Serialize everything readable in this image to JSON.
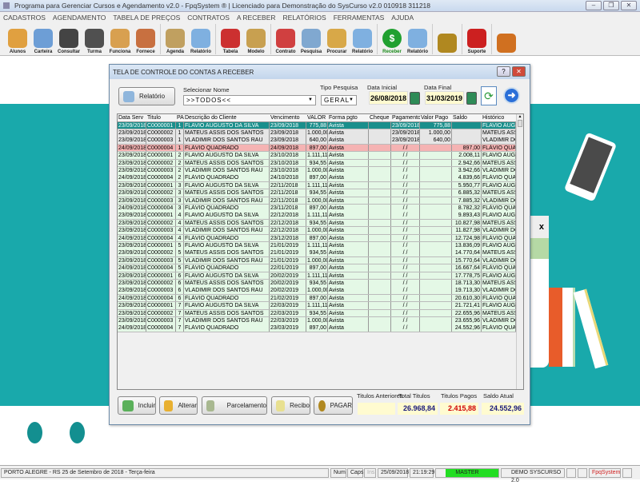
{
  "window": {
    "title": "Programa para Gerenciar Cursos e Agendamento v2.0 - FpqSystem ® | Licenciado para  Demonstração do SysCurso v2.0 010918 311218"
  },
  "menu": [
    "CADASTROS",
    "AGENDAMENTO",
    "TABELA DE PREÇOS",
    "CONTRATOS",
    "A RECEBER",
    "RELATÓRIOS",
    "FERRAMENTAS",
    "AJUDA"
  ],
  "toolbar": [
    {
      "label": "Alunos",
      "icon": "students-icon",
      "color": "#e0a040"
    },
    {
      "label": "Carteira",
      "icon": "id-card-icon",
      "color": "#6d9ed6"
    },
    {
      "label": "Consultar",
      "icon": "consult-icon",
      "color": "#444444"
    },
    {
      "label": "Turma",
      "icon": "classroom-icon",
      "color": "#505050"
    },
    {
      "label": "Funciona",
      "icon": "employee-icon",
      "color": "#d8a050"
    },
    {
      "label": "Fornece",
      "icon": "supplier-icon",
      "color": "#c87040",
      "sep": true
    },
    {
      "label": "Agenda",
      "icon": "calendar-icon",
      "color": "#c0a060"
    },
    {
      "label": "Relatório",
      "icon": "printer-icon",
      "color": "#7fb0e0",
      "sep": true
    },
    {
      "label": "Tabela",
      "icon": "table-doc-icon",
      "color": "#cc3030"
    },
    {
      "label": "Modelo",
      "icon": "scroll-icon",
      "color": "#c8a050",
      "sep": true
    },
    {
      "label": "Contrato",
      "icon": "pen-icon",
      "color": "#d04040"
    },
    {
      "label": "Pesquisa",
      "icon": "search-doc-icon",
      "color": "#80a8d0"
    },
    {
      "label": "Procurar",
      "icon": "archive-icon",
      "color": "#d8a848"
    },
    {
      "label": "Relatório",
      "icon": "printer-icon",
      "color": "#7fb0e0",
      "sep": true
    },
    {
      "label": "Receber",
      "icon": "dollar-icon",
      "color": "#20a030"
    },
    {
      "label": "Relatório",
      "icon": "printer-icon",
      "color": "#7fb0e0",
      "sep": true
    },
    {
      "label": "",
      "icon": "coins-icon",
      "color": "#b08820",
      "sep": true
    },
    {
      "label": "Suporte",
      "icon": "support-icon",
      "color": "#cc2020",
      "sep": true
    },
    {
      "label": "",
      "icon": "exit-icon",
      "color": "#d07020"
    }
  ],
  "dialog": {
    "title": "TELA DE CONTROLE DO CONTAS A RECEBER",
    "report_button": "Relatório",
    "select_name_label": "Selecionar Nome",
    "select_name_value": ">>TODOS<<",
    "search_type_label": "Tipo  Pesquisa",
    "search_type_value": "GERAL",
    "start_date_label": "Data Inicial",
    "start_date": "26/08/2018",
    "end_date_label": "Data Final",
    "end_date": "31/03/2019",
    "columns": [
      "Data Serv",
      "Titulo",
      "PA",
      "Descrição do Cliente",
      "Vencimento",
      "VALOR",
      "Forma pgto",
      "Cheque",
      "Pagamento",
      "Valor Pago",
      "Saldo",
      "Histórico"
    ],
    "row_colors": {
      "selected": "#1a8f8c",
      "paid": "#e6e6e6",
      "overdue": "#f5b3b3",
      "open": "#e4f8e6"
    },
    "rows": [
      [
        "23/09/2018",
        "C0000001",
        "1",
        "FLAVIO AUGUSTO DA SILVA",
        "23/09/2018",
        "775,88",
        "Avista",
        "",
        "23/09/2018",
        "775,88",
        "",
        "FLAVIO AUGU",
        "selected"
      ],
      [
        "23/09/2018",
        "C0000002",
        "1",
        "MATEUS ASSIS DOS SANTOS",
        "23/09/2018",
        "1.000,00",
        "Avista",
        "",
        "23/09/2018",
        "1.000,00",
        "",
        "MATEUS ASSI",
        "paid"
      ],
      [
        "23/09/2018",
        "C0000003",
        "1",
        "VLADIMIR DOS SANTOS RAU",
        "23/09/2018",
        "640,00",
        "Avista",
        "",
        "23/09/2018",
        "640,00",
        "",
        "VLADIMIR DO",
        "paid"
      ],
      [
        "24/09/2018",
        "C0000004",
        "1",
        "FLÁVIO QUADRADO",
        "24/09/2018",
        "897,00",
        "Avista",
        "",
        "/ /",
        "",
        "897,00",
        "FLÁVIO QUAD",
        "overdue"
      ],
      [
        "23/09/2018",
        "C0000001",
        "2",
        "FLAVIO AUGUSTO DA SILVA",
        "23/10/2018",
        "1.111,11",
        "Avista",
        "",
        "/ /",
        "",
        "2.008,11",
        "FLAVIO AUGU",
        "open"
      ],
      [
        "23/09/2018",
        "C0000002",
        "2",
        "MATEUS ASSIS DOS SANTOS",
        "23/10/2018",
        "934,55",
        "Avista",
        "",
        "/ /",
        "",
        "2.942,66",
        "MATEUS ASSI",
        "open"
      ],
      [
        "23/09/2018",
        "C0000003",
        "2",
        "VLADIMIR DOS SANTOS RAU",
        "23/10/2018",
        "1.000,00",
        "Avista",
        "",
        "/ /",
        "",
        "3.942,66",
        "VLADIMIR DO",
        "open"
      ],
      [
        "24/09/2018",
        "C0000004",
        "2",
        "FLÁVIO QUADRADO",
        "24/10/2018",
        "897,00",
        "Avista",
        "",
        "/ /",
        "",
        "4.839,66",
        "FLÁVIO QUAD",
        "open"
      ],
      [
        "23/09/2018",
        "C0000001",
        "3",
        "FLAVIO AUGUSTO DA SILVA",
        "22/11/2018",
        "1.111,11",
        "Avista",
        "",
        "/ /",
        "",
        "5.950,77",
        "FLAVIO AUGU",
        "open"
      ],
      [
        "23/09/2018",
        "C0000002",
        "3",
        "MATEUS ASSIS DOS SANTOS",
        "22/11/2018",
        "934,55",
        "Avista",
        "",
        "/ /",
        "",
        "6.885,32",
        "MATEUS ASSI",
        "open"
      ],
      [
        "23/09/2018",
        "C0000003",
        "3",
        "VLADIMIR DOS SANTOS RAU",
        "22/11/2018",
        "1.000,00",
        "Avista",
        "",
        "/ /",
        "",
        "7.885,32",
        "VLADIMIR DO",
        "open"
      ],
      [
        "24/09/2018",
        "C0000004",
        "3",
        "FLÁVIO QUADRADO",
        "23/11/2018",
        "897,00",
        "Avista",
        "",
        "/ /",
        "",
        "8.782,32",
        "FLÁVIO QUAD",
        "open"
      ],
      [
        "23/09/2018",
        "C0000001",
        "4",
        "FLAVIO AUGUSTO DA SILVA",
        "22/12/2018",
        "1.111,11",
        "Avista",
        "",
        "/ /",
        "",
        "9.893,43",
        "FLAVIO AUGU",
        "open"
      ],
      [
        "23/09/2018",
        "C0000002",
        "4",
        "MATEUS ASSIS DOS SANTOS",
        "22/12/2018",
        "934,55",
        "Avista",
        "",
        "/ /",
        "",
        "10.827,98",
        "MATEUS ASSI",
        "open"
      ],
      [
        "23/09/2018",
        "C0000003",
        "4",
        "VLADIMIR DOS SANTOS RAU",
        "22/12/2018",
        "1.000,00",
        "Avista",
        "",
        "/ /",
        "",
        "11.827,98",
        "VLADIMIR DO",
        "open"
      ],
      [
        "24/09/2018",
        "C0000004",
        "4",
        "FLÁVIO QUADRADO",
        "23/12/2018",
        "897,00",
        "Avista",
        "",
        "/ /",
        "",
        "12.724,98",
        "FLÁVIO QUAD",
        "open"
      ],
      [
        "23/09/2018",
        "C0000001",
        "5",
        "FLAVIO AUGUSTO DA SILVA",
        "21/01/2019",
        "1.111,11",
        "Avista",
        "",
        "/ /",
        "",
        "13.836,09",
        "FLAVIO AUGU",
        "open"
      ],
      [
        "23/09/2018",
        "C0000002",
        "5",
        "MATEUS ASSIS DOS SANTOS",
        "21/01/2019",
        "934,55",
        "Avista",
        "",
        "/ /",
        "",
        "14.770,64",
        "MATEUS ASSI",
        "open"
      ],
      [
        "23/09/2018",
        "C0000003",
        "5",
        "VLADIMIR DOS SANTOS RAU",
        "21/01/2019",
        "1.000,00",
        "Avista",
        "",
        "/ /",
        "",
        "15.770,64",
        "VLADIMIR DO",
        "open"
      ],
      [
        "24/09/2018",
        "C0000004",
        "5",
        "FLÁVIO QUADRADO",
        "22/01/2019",
        "897,00",
        "Avista",
        "",
        "/ /",
        "",
        "16.667,64",
        "FLÁVIO QUAD",
        "open"
      ],
      [
        "23/09/2018",
        "C0000001",
        "6",
        "FLAVIO AUGUSTO DA SILVA",
        "20/02/2019",
        "1.111,11",
        "Avista",
        "",
        "/ /",
        "",
        "17.778,75",
        "FLAVIO AUGU",
        "open"
      ],
      [
        "23/09/2018",
        "C0000002",
        "6",
        "MATEUS ASSIS DOS SANTOS",
        "20/02/2019",
        "934,55",
        "Avista",
        "",
        "/ /",
        "",
        "18.713,30",
        "MATEUS ASSI",
        "open"
      ],
      [
        "23/09/2018",
        "C0000003",
        "6",
        "VLADIMIR DOS SANTOS RAU",
        "20/02/2019",
        "1.000,00",
        "Avista",
        "",
        "/ /",
        "",
        "19.713,30",
        "VLADIMIR DO",
        "open"
      ],
      [
        "24/09/2018",
        "C0000004",
        "6",
        "FLÁVIO QUADRADO",
        "21/02/2019",
        "897,00",
        "Avista",
        "",
        "/ /",
        "",
        "20.610,30",
        "FLÁVIO QUAD",
        "open"
      ],
      [
        "23/09/2018",
        "C0000001",
        "7",
        "FLAVIO AUGUSTO DA SILVA",
        "22/03/2019",
        "1.111,11",
        "Avista",
        "",
        "/ /",
        "",
        "21.721,41",
        "FLAVIO AUGU",
        "open"
      ],
      [
        "23/09/2018",
        "C0000002",
        "7",
        "MATEUS ASSIS DOS SANTOS",
        "22/03/2019",
        "934,55",
        "Avista",
        "",
        "/ /",
        "",
        "22.655,96",
        "MATEUS ASSI",
        "open"
      ],
      [
        "23/09/2018",
        "C0000003",
        "7",
        "VLADIMIR DOS SANTOS RAU",
        "22/03/2019",
        "1.000,00",
        "Avista",
        "",
        "/ /",
        "",
        "23.655,96",
        "VLADIMIR DO",
        "open"
      ],
      [
        "24/09/2018",
        "C0000004",
        "7",
        "FLÁVIO QUADRADO",
        "23/03/2019",
        "897,00",
        "Avista",
        "",
        "/ /",
        "",
        "24.552,96",
        "FLÁVIO QUAD",
        "open"
      ]
    ],
    "buttons": {
      "include": "Incluir",
      "edit": "Alterar",
      "installments": "Parcelamento",
      "receipt": "Recibo",
      "pay": "PAGAR"
    },
    "totals": {
      "previous_label": "Titulos Anteriores",
      "previous": "",
      "total_label": "Total Titulos",
      "total": "26.968,84",
      "paid_label": "Titulos Pagos",
      "paid": "2.415,88",
      "balance_label": "Saldo Atual",
      "balance": "24.552,96"
    }
  },
  "status": {
    "location": "PORTO ALEGRE - RS 25 de Setembro de 2018 - Terça-feira",
    "num": "Num",
    "caps": "Caps",
    "ins": "Ins",
    "date": "25/09/2018",
    "time": "21:19:29",
    "user": "MASTER",
    "product": "DEMO SYSCURSO 2.0",
    "brand": "FpqSystem"
  }
}
